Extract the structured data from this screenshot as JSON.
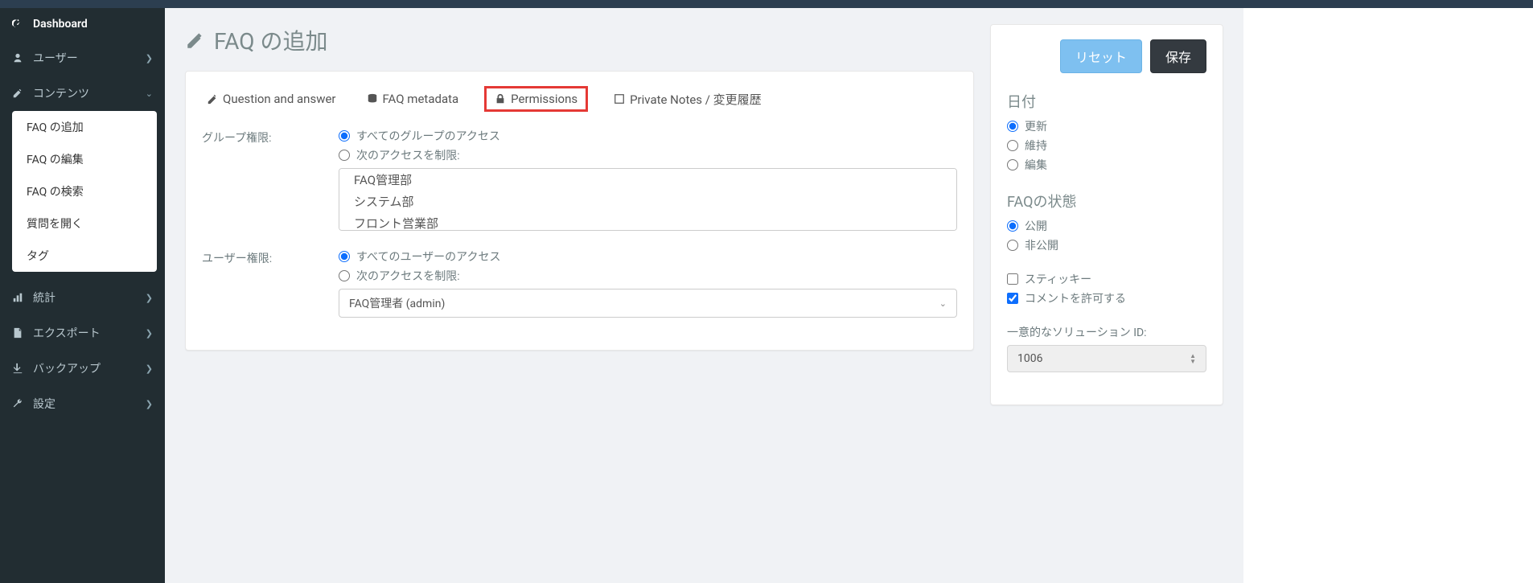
{
  "sidebar": {
    "dashboard": "Dashboard",
    "items": [
      {
        "label": "ユーザー"
      },
      {
        "label": "コンテンツ"
      },
      {
        "label": "統計"
      },
      {
        "label": "エクスポート"
      },
      {
        "label": "バックアップ"
      },
      {
        "label": "設定"
      }
    ],
    "submenu": [
      "FAQ の追加",
      "FAQ の編集",
      "FAQ の検索",
      "質問を開く",
      "タグ"
    ]
  },
  "page": {
    "title": "FAQ の追加"
  },
  "tabs": {
    "qa": "Question and answer",
    "meta": "FAQ metadata",
    "perm": "Permissions",
    "notes": "Private Notes / 変更履歴"
  },
  "perm": {
    "group_label": "グループ権限:",
    "group_all": "すべてのグループのアクセス",
    "group_restrict": "次のアクセスを制限:",
    "group_options": [
      "FAQ管理部",
      "システム部",
      "フロント営業部"
    ],
    "user_label": "ユーザー権限:",
    "user_all": "すべてのユーザーのアクセス",
    "user_restrict": "次のアクセスを制限:",
    "user_selected": "FAQ管理者 (admin)"
  },
  "side": {
    "reset": "リセット",
    "save": "保存",
    "date_heading": "日付",
    "date_update": "更新",
    "date_keep": "維持",
    "date_edit": "編集",
    "state_heading": "FAQの状態",
    "state_public": "公開",
    "state_private": "非公開",
    "sticky": "スティッキー",
    "allow_comments": "コメントを許可する",
    "solution_id_label": "一意的なソリューション ID:",
    "solution_id_value": "1006"
  }
}
